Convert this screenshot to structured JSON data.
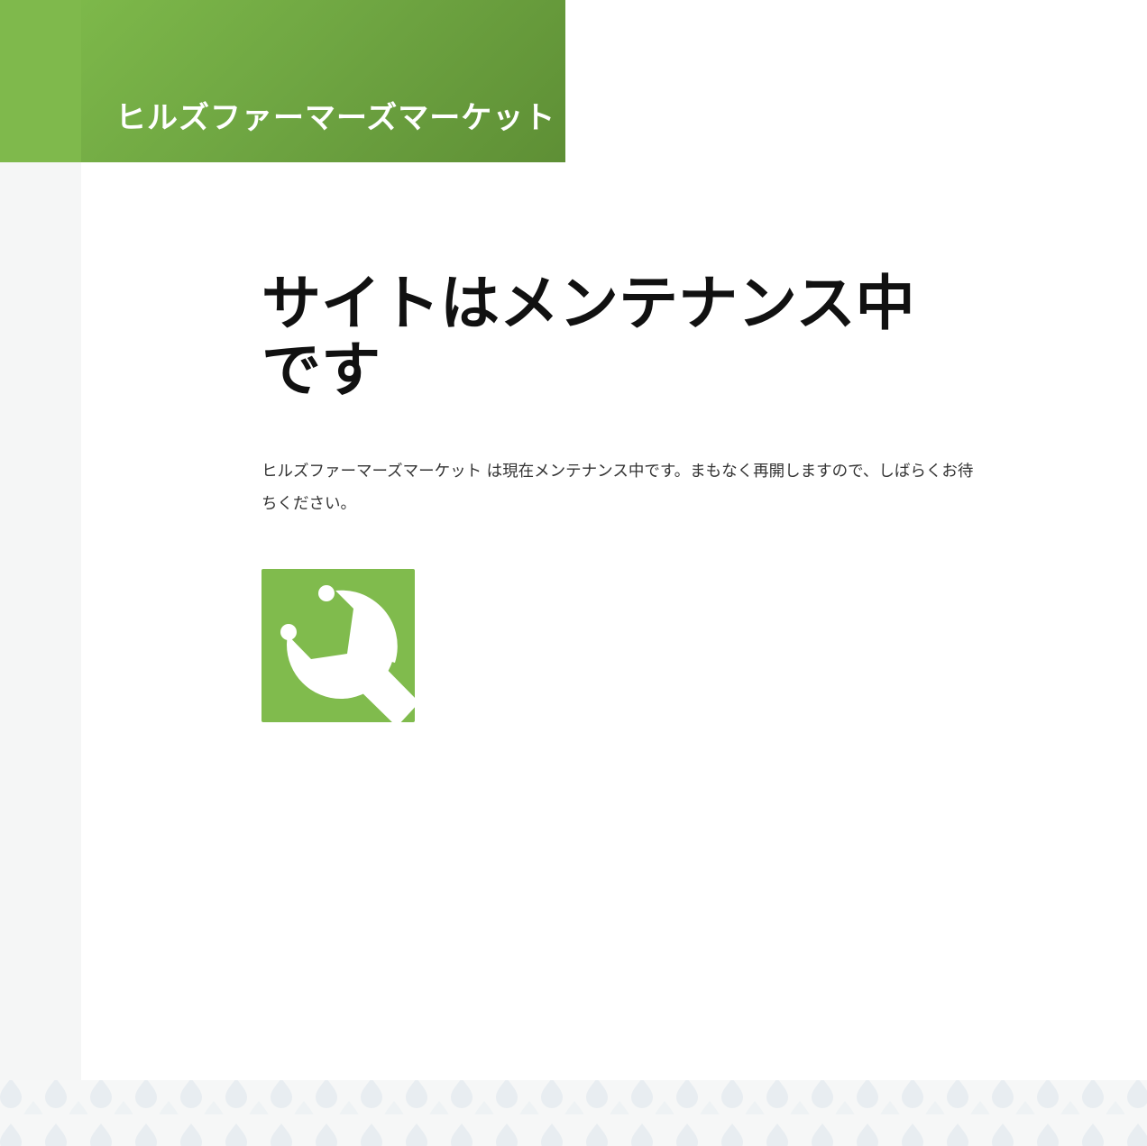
{
  "site": {
    "title": "ヒルズファーマーズマーケット"
  },
  "main": {
    "heading": "サイトはメンテナンス中です",
    "message": "ヒルズファーマーズマーケット は現在メンテナンス中です。まもなく再開しますので、しばらくお待ちください。"
  },
  "icons": {
    "maintenance": "wrench-icon",
    "footer_pattern": "droplet-icon"
  },
  "colors": {
    "brand_green": "#80bb4d",
    "header_dark_green": "#5e8f35",
    "heading_text": "#111111",
    "body_text": "#333333",
    "pattern_drop": "#e8edf1"
  }
}
